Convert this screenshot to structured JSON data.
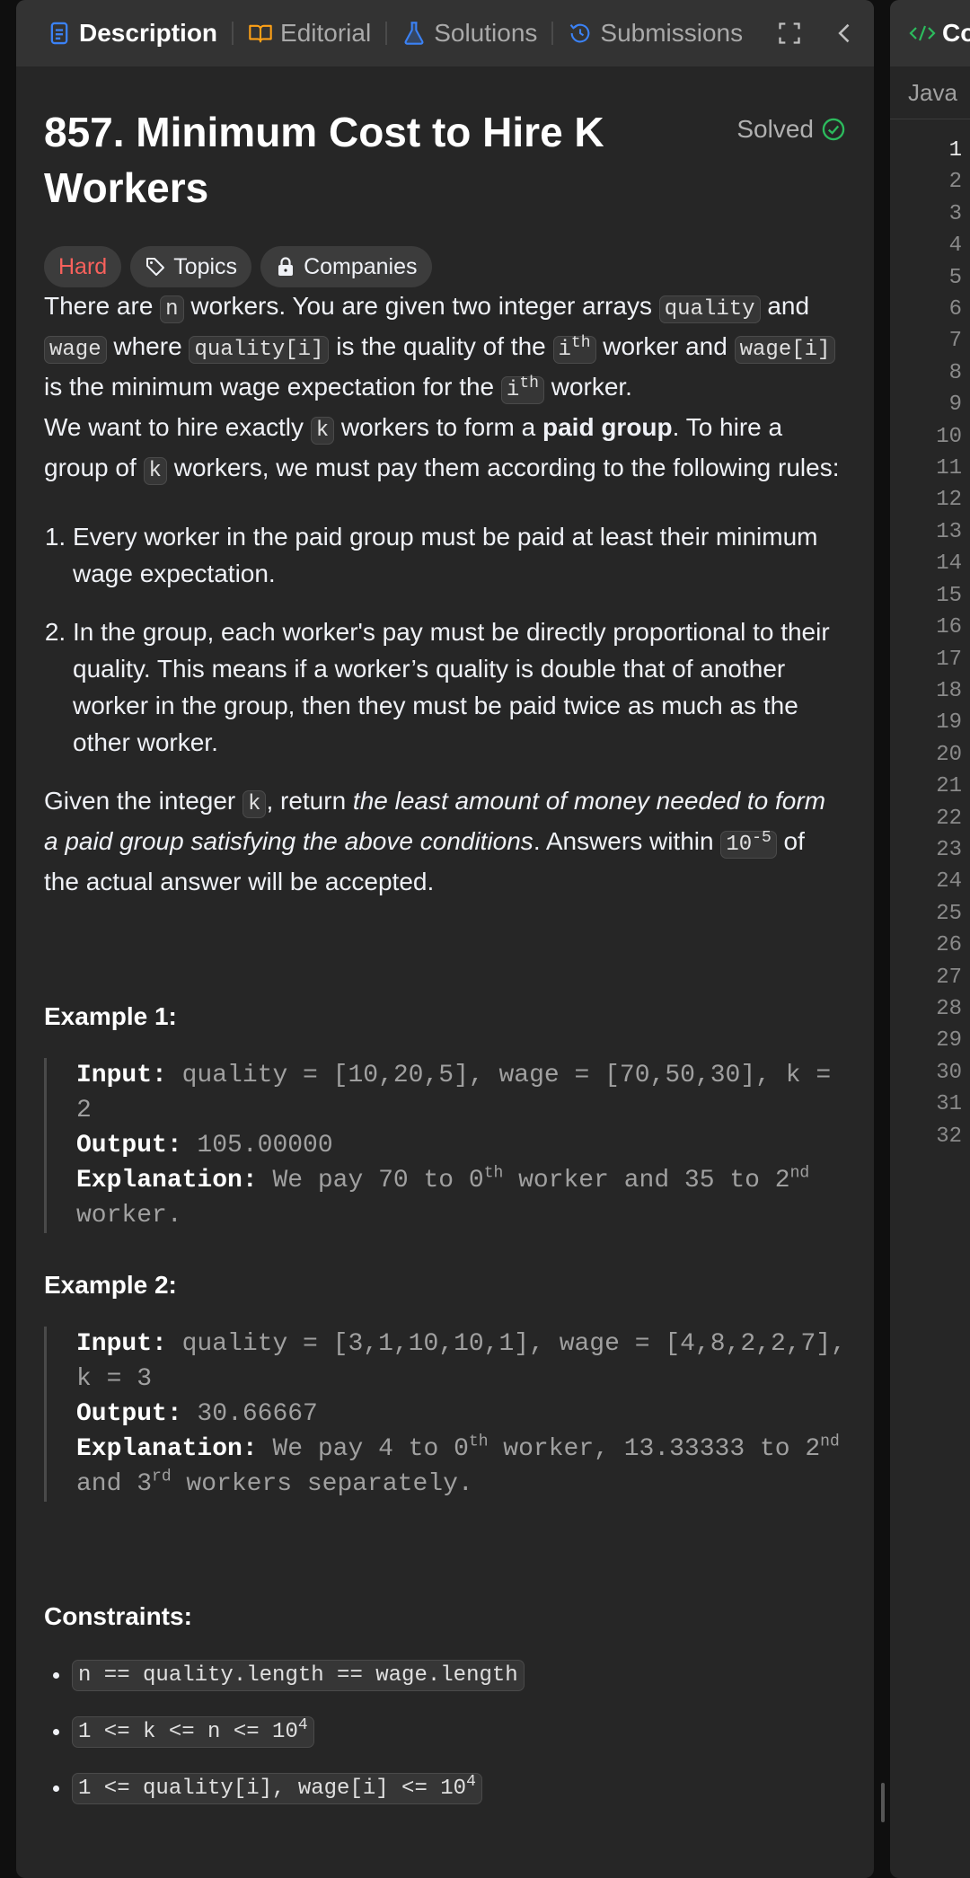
{
  "tabs": {
    "description": "Description",
    "editorial": "Editorial",
    "solutions": "Solutions",
    "submissions": "Submissions"
  },
  "problem": {
    "title": "857. Minimum Cost to Hire K Workers",
    "status": "Solved",
    "difficulty": "Hard",
    "topics_label": "Topics",
    "companies_label": "Companies"
  },
  "statement": {
    "p1": {
      "a": "There are ",
      "n": "n",
      "b": " workers. You are given two integer arrays ",
      "quality": "quality",
      "c": " and ",
      "wage": "wage",
      "d": " where ",
      "quality_i": "quality[i]",
      "e": " is the quality of the ",
      "i": "i",
      "th": "th",
      "f": " worker and ",
      "wage_i": "wage[i]",
      "g": " is the minimum wage expectation for the ",
      "h": " worker."
    },
    "p2": {
      "a": "We want to hire exactly ",
      "k": "k",
      "b": " workers to form a ",
      "bold": "paid group",
      "c": ". To hire a group of ",
      "d": " workers, we must pay them according to the following rules:"
    },
    "rules": [
      "Every worker in the paid group must be paid at least their minimum wage expectation.",
      "In the group, each worker's pay must be directly proportional to their quality. This means if a worker’s quality is double that of another worker in the group, then they must be paid twice as much as the other worker."
    ],
    "p3": {
      "a": "Given the integer ",
      "k": "k",
      "b": ", return ",
      "em": "the least amount of money needed to form a paid group satisfying the above conditions",
      "c": ". Answers within ",
      "tol_base": "10",
      "tol_exp": "-5",
      "d": " of the actual answer will be accepted."
    }
  },
  "examples": [
    {
      "title": "Example 1:",
      "input_label": "Input:",
      "input": " quality = [10,20,5], wage = [70,50,30], k = 2",
      "output_label": "Output:",
      "output": " 105.00000",
      "explanation_label": "Explanation:",
      "expl_a": " We pay 70 to 0",
      "expl_sup1": "th",
      "expl_b": " worker and 35 to 2",
      "expl_sup2": "nd",
      "expl_c": " worker."
    },
    {
      "title": "Example 2:",
      "input_label": "Input:",
      "input": " quality = [3,1,10,10,1], wage = [4,8,2,2,7], k = 3",
      "output_label": "Output:",
      "output": " 30.66667",
      "explanation_label": "Explanation:",
      "expl_a": " We pay 4 to 0",
      "expl_sup1": "th",
      "expl_b": " worker, 13.33333 to 2",
      "expl_sup2": "nd",
      "expl_c": " and 3",
      "expl_sup3": "rd",
      "expl_d": " workers separately."
    }
  ],
  "constraints": {
    "title": "Constraints:",
    "c1": "n == quality.length == wage.length",
    "c2": "1 <= k <= n <= 10",
    "c2_exp": "4",
    "c3": "1 <= quality[i], wage[i] <= 10",
    "c3_exp": "4"
  },
  "editor": {
    "tab_label": "Co",
    "language": "Java",
    "line_numbers": [
      "1",
      "2",
      "3",
      "4",
      "5",
      "6",
      "7",
      "8",
      "9",
      "10",
      "11",
      "12",
      "13",
      "14",
      "15",
      "16",
      "17",
      "18",
      "19",
      "20",
      "21",
      "22",
      "23",
      "24",
      "25",
      "26",
      "27",
      "28",
      "29",
      "30",
      "31",
      "32"
    ]
  },
  "colors": {
    "hard": "#f8615c",
    "solved": "#2cbb5d",
    "description_icon": "#3b82f6",
    "editorial_icon": "#ffa116",
    "solutions_icon": "#3b82f6"
  }
}
